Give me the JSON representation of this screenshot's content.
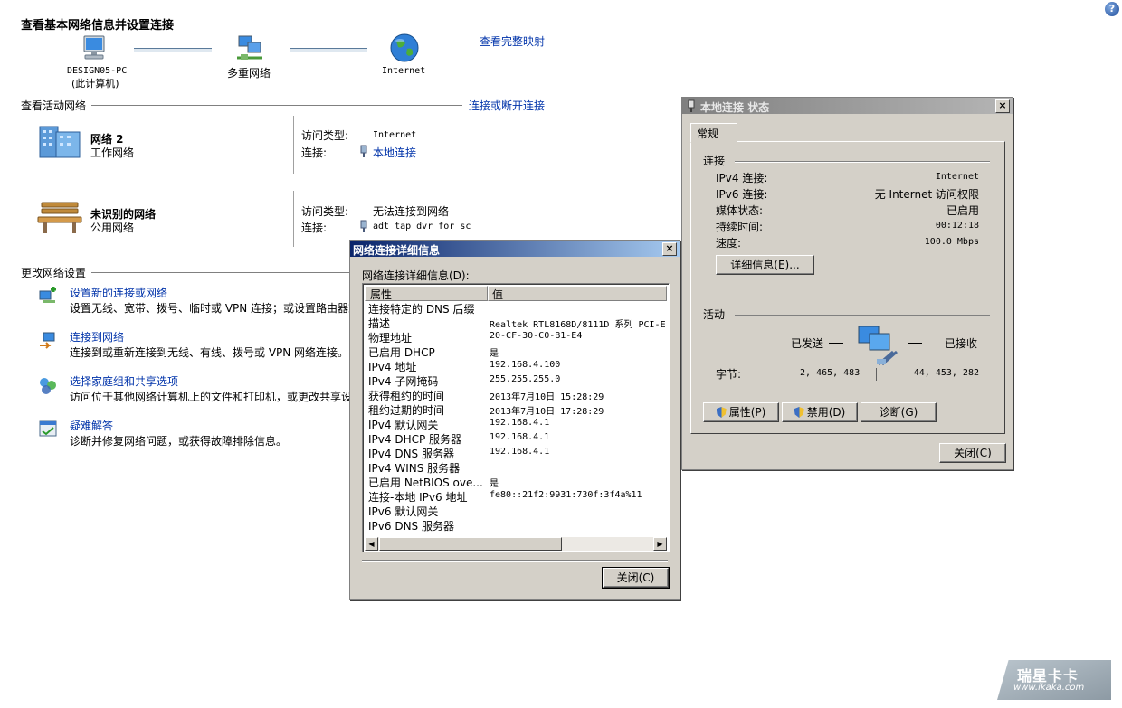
{
  "help_icon": "help-icon",
  "header": {
    "title": "查看基本网络信息并设置连接",
    "view_full_map": "查看完整映射"
  },
  "map": {
    "pc_name": "DESIGN05-PC",
    "pc_sub": "(此计算机)",
    "multi_network": "多重网络",
    "internet": "Internet"
  },
  "active": {
    "section_title": "查看活动网络",
    "connect_link": "连接或断开连接",
    "networks": [
      {
        "name": "网络  2",
        "type": "工作网络",
        "access_label": "访问类型:",
        "access_value": "Internet",
        "conn_label": "连接:",
        "conn_value": "本地连接"
      },
      {
        "name": "未识别的网络",
        "type": "公用网络",
        "access_label": "访问类型:",
        "access_value": "无法连接到网络",
        "conn_label": "连接:",
        "conn_value": "adt tap dvr for sc"
      }
    ]
  },
  "change": {
    "section_title": "更改网络设置",
    "tasks": [
      {
        "title": "设置新的连接或网络",
        "desc": "设置无线、宽带、拨号、临时或 VPN 连接；或设置路由器或"
      },
      {
        "title": "连接到网络",
        "desc": "连接到或重新连接到无线、有线、拨号或 VPN 网络连接。"
      },
      {
        "title": "选择家庭组和共享选项",
        "desc": "访问位于其他网络计算机上的文件和打印机，或更改共享设"
      },
      {
        "title": "疑难解答",
        "desc": "诊断并修复网络问题，或获得故障排除信息。"
      }
    ]
  },
  "status_dialog": {
    "title": "本地连接 状态",
    "tab": "常规",
    "connection_group": "连接",
    "rows": [
      {
        "label": "IPv4 连接:",
        "value": "Internet"
      },
      {
        "label": "IPv6 连接:",
        "value": "无 Internet 访问权限"
      },
      {
        "label": "媒体状态:",
        "value": "已启用"
      },
      {
        "label": "持续时间:",
        "value": "00:12:18"
      },
      {
        "label": "速度:",
        "value": "100.0 Mbps"
      }
    ],
    "details_button": "详细信息(E)...",
    "activity_group": "活动",
    "sent_label": "已发送",
    "received_label": "已接收",
    "bytes_label": "字节:",
    "bytes_sent": "2, 465, 483",
    "bytes_received": "44, 453, 282",
    "properties_button": "属性(P)",
    "disable_button": "禁用(D)",
    "diagnose_button": "诊断(G)",
    "close_button": "关闭(C)"
  },
  "details_dialog": {
    "title": "网络连接详细信息",
    "list_label": "网络连接详细信息(D):",
    "col_property": "属性",
    "col_value": "值",
    "rows": [
      {
        "p": "连接特定的 DNS 后缀",
        "v": ""
      },
      {
        "p": "描述",
        "v": "Realtek RTL8168D/8111D 系列 PCI-E"
      },
      {
        "p": "物理地址",
        "v": "20-CF-30-C0-B1-E4"
      },
      {
        "p": "已启用 DHCP",
        "v": "是"
      },
      {
        "p": "IPv4 地址",
        "v": "192.168.4.100"
      },
      {
        "p": "IPv4 子网掩码",
        "v": "255.255.255.0"
      },
      {
        "p": "获得租约的时间",
        "v": "2013年7月10日 15:28:29"
      },
      {
        "p": "租约过期的时间",
        "v": "2013年7月10日 17:28:29"
      },
      {
        "p": "IPv4 默认网关",
        "v": "192.168.4.1"
      },
      {
        "p": "IPv4 DHCP 服务器",
        "v": "192.168.4.1"
      },
      {
        "p": "IPv4 DNS 服务器",
        "v": "192.168.4.1"
      },
      {
        "p": "IPv4 WINS 服务器",
        "v": ""
      },
      {
        "p": "已启用 NetBIOS ove...",
        "v": "是"
      },
      {
        "p": "连接-本地 IPv6 地址",
        "v": "fe80::21f2:9931:730f:3f4a%11"
      },
      {
        "p": "IPv6 默认网关",
        "v": ""
      },
      {
        "p": "IPv6 DNS 服务器",
        "v": ""
      }
    ],
    "close_button": "关闭(C)"
  },
  "watermark": {
    "brand": "瑞星卡卡",
    "url": "www.ikaka.com"
  }
}
